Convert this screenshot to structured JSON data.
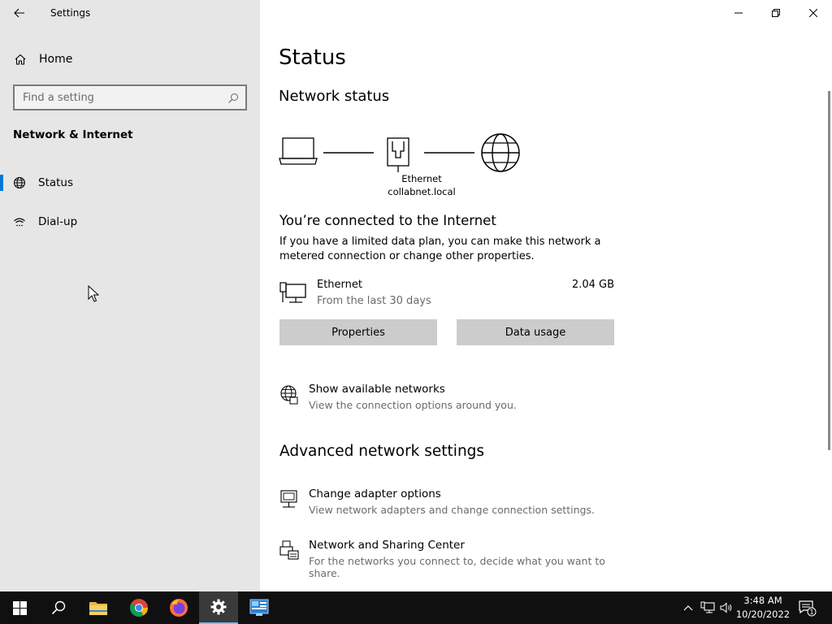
{
  "window": {
    "title": "Settings",
    "controls": {
      "minimize": "minimize",
      "restore": "restore",
      "close": "close"
    }
  },
  "sidebar": {
    "home_label": "Home",
    "search_placeholder": "Find a setting",
    "section_heading": "Network & Internet",
    "items": [
      {
        "label": "Status",
        "icon": "globe-status-icon",
        "active": true
      },
      {
        "label": "Dial-up",
        "icon": "dial-up-icon",
        "active": false
      }
    ]
  },
  "main": {
    "page_title": "Status",
    "network_status_heading": "Network status",
    "diagram": {
      "adapter_label": "Ethernet",
      "network_name": "collabnet.local"
    },
    "connected_heading": "You’re connected to the Internet",
    "connected_description": "If you have a limited data plan, you can make this network a metered connection or change other properties.",
    "connection": {
      "name": "Ethernet",
      "period": "From the last 30 days",
      "usage": "2.04 GB"
    },
    "buttons": {
      "properties": "Properties",
      "data_usage": "Data usage"
    },
    "show_networks": {
      "label": "Show available networks",
      "description": "View the connection options around you."
    },
    "advanced_heading": "Advanced network settings",
    "adapter_options": {
      "label": "Change adapter options",
      "description": "View network adapters and change connection settings."
    },
    "sharing_center": {
      "label": "Network and Sharing Center",
      "description": "For the networks you connect to, decide what you want to share."
    }
  },
  "taskbar": {
    "apps": [
      "start",
      "search",
      "file-explorer",
      "chrome",
      "firefox",
      "settings",
      "control-panel"
    ],
    "active_app": "settings",
    "clock": {
      "time": "3:48 AM",
      "date": "10/20/2022"
    },
    "notification_count": "1",
    "colors": {
      "accent": "#0078d7",
      "taskbar": "#101010"
    }
  }
}
